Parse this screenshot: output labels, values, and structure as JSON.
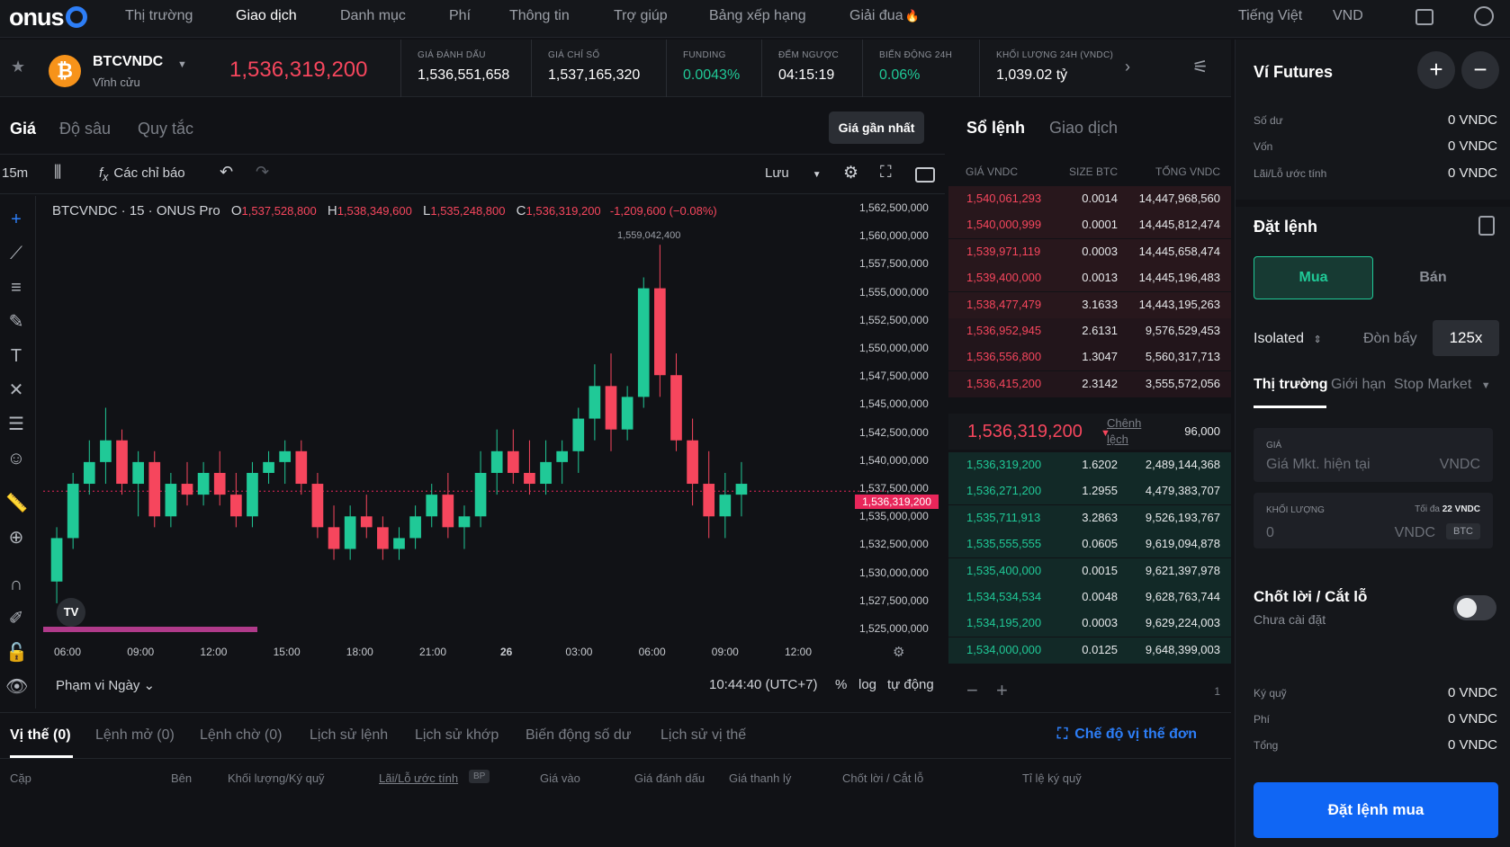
{
  "brand": {
    "name": "onus"
  },
  "nav": [
    "Thị trường",
    "Giao dịch",
    "Danh mục",
    "Phí",
    "Thông tin",
    "Trợ giúp",
    "Bảng xếp hạng",
    "Giải đua"
  ],
  "nav_right": {
    "lang": "Tiếng Việt",
    "currency": "VND"
  },
  "ticker": {
    "coin_letter": "₿",
    "symbol": "BTCVNDC",
    "type": "Vĩnh cửu",
    "last_price": "1,536,319,200",
    "stats": [
      {
        "label": "GIÁ ĐÁNH DẤU",
        "value": "1,536,551,658"
      },
      {
        "label": "GIÁ CHỈ SỐ",
        "value": "1,537,165,320"
      },
      {
        "label": "FUNDING",
        "value": "0.0043%"
      },
      {
        "label": "ĐẾM NGƯỢC",
        "value": "04:15:19"
      },
      {
        "label": "BIẾN ĐỘNG 24H",
        "value": "0.06%"
      },
      {
        "label": "KHỐI LƯỢNG 24H (VNDC)",
        "value": "1,039.02 tỷ"
      }
    ]
  },
  "chart_tabs": [
    "Giá",
    "Độ sâu",
    "Quy tắc"
  ],
  "last_price_button": "Giá gần nhất",
  "toolbar": {
    "interval": "15m",
    "indicators": "Các chỉ báo",
    "save": "Lưu"
  },
  "ohlc": {
    "title": "BTCVNDC · 15 · ONUS Pro",
    "o": "1,537,528,800",
    "h": "1,538,349,600",
    "l": "1,535,248,800",
    "c": "1,536,319,200",
    "change": "-1,209,600 (−0.08%)"
  },
  "chart_data": {
    "type": "candlestick",
    "symbol": "BTCVNDC",
    "interval": "15",
    "y_ticks": [
      "1,562,500,000",
      "1,560,000,000",
      "1,557,500,000",
      "1,555,000,000",
      "1,552,500,000",
      "1,550,000,000",
      "1,547,500,000",
      "1,545,000,000",
      "1,542,500,000",
      "1,540,000,000",
      "1,537,500,000",
      "1,535,000,000",
      "1,532,500,000",
      "1,530,000,000",
      "1,527,500,000",
      "1,525,000,000"
    ],
    "x_ticks": [
      "06:00",
      "09:00",
      "12:00",
      "15:00",
      "18:00",
      "21:00",
      "26",
      "03:00",
      "06:00",
      "09:00",
      "12:00"
    ],
    "ylim": [
      1525000000,
      1562500000
    ],
    "high_annotation": "1,559,042,400",
    "current_price_label": "1,536,319,200",
    "candles": [
      [
        1528000000,
        1533000000,
        1526000000,
        1532000000
      ],
      [
        1532000000,
        1538000000,
        1531000000,
        1537000000
      ],
      [
        1537000000,
        1541000000,
        1536000000,
        1539000000
      ],
      [
        1539000000,
        1544000000,
        1537000000,
        1541000000
      ],
      [
        1541000000,
        1542000000,
        1536000000,
        1537000000
      ],
      [
        1537000000,
        1540000000,
        1534000000,
        1539000000
      ],
      [
        1539000000,
        1540000000,
        1533000000,
        1534000000
      ],
      [
        1534000000,
        1538000000,
        1533000000,
        1537000000
      ],
      [
        1537000000,
        1539000000,
        1535000000,
        1536000000
      ],
      [
        1536000000,
        1539000000,
        1535000000,
        1538000000
      ],
      [
        1538000000,
        1540000000,
        1535000000,
        1536000000
      ],
      [
        1536000000,
        1538000000,
        1533000000,
        1534000000
      ],
      [
        1534000000,
        1539000000,
        1533000000,
        1538000000
      ],
      [
        1538000000,
        1540000000,
        1537000000,
        1539000000
      ],
      [
        1539000000,
        1541000000,
        1537000000,
        1540000000
      ],
      [
        1540000000,
        1541000000,
        1536000000,
        1537000000
      ],
      [
        1537000000,
        1538000000,
        1532000000,
        1533000000
      ],
      [
        1533000000,
        1535000000,
        1530000000,
        1531000000
      ],
      [
        1531000000,
        1535000000,
        1530000000,
        1534000000
      ],
      [
        1534000000,
        1536000000,
        1532000000,
        1533000000
      ],
      [
        1533000000,
        1534000000,
        1530000000,
        1531000000
      ],
      [
        1531000000,
        1533000000,
        1530000000,
        1532000000
      ],
      [
        1532000000,
        1535000000,
        1531000000,
        1534000000
      ],
      [
        1534000000,
        1537000000,
        1533000000,
        1536000000
      ],
      [
        1536000000,
        1538000000,
        1532000000,
        1533000000
      ],
      [
        1533000000,
        1535000000,
        1531000000,
        1534000000
      ],
      [
        1534000000,
        1540000000,
        1533000000,
        1538000000
      ],
      [
        1538000000,
        1542000000,
        1536000000,
        1540000000
      ],
      [
        1540000000,
        1542000000,
        1537000000,
        1538000000
      ],
      [
        1538000000,
        1541000000,
        1536000000,
        1537000000
      ],
      [
        1537000000,
        1541000000,
        1536000000,
        1539000000
      ],
      [
        1539000000,
        1541000000,
        1537000000,
        1540000000
      ],
      [
        1540000000,
        1544000000,
        1538000000,
        1543000000
      ],
      [
        1543000000,
        1548000000,
        1541000000,
        1546000000
      ],
      [
        1546000000,
        1549000000,
        1540000000,
        1542000000
      ],
      [
        1542000000,
        1546000000,
        1541000000,
        1545000000
      ],
      [
        1545000000,
        1556000000,
        1544000000,
        1555000000
      ],
      [
        1555000000,
        1559000000,
        1545000000,
        1547000000
      ],
      [
        1547000000,
        1549000000,
        1540000000,
        1541000000
      ],
      [
        1541000000,
        1543000000,
        1535000000,
        1537000000
      ],
      [
        1537000000,
        1540000000,
        1532000000,
        1534000000
      ],
      [
        1534000000,
        1538000000,
        1532000000,
        1536000000
      ],
      [
        1536000000,
        1539000000,
        1534000000,
        1537000000
      ]
    ]
  },
  "chart_footer": {
    "range": "Phạm vi Ngày",
    "time": "10:44:40 (UTC+7)",
    "pct": "%",
    "log": "log",
    "auto": "tự động"
  },
  "orderbook": {
    "tabs": [
      "Sổ lệnh",
      "Giao dịch"
    ],
    "headers": {
      "price": "GIÁ VNDC",
      "size": "SIZE BTC",
      "total": "TỔNG VNDC"
    },
    "asks": [
      [
        "1,540,061,293",
        "0.0014",
        "14,447,968,560"
      ],
      [
        "1,540,000,999",
        "0.0001",
        "14,445,812,474"
      ],
      [
        "1,539,971,119",
        "0.0003",
        "14,445,658,474"
      ],
      [
        "1,539,400,000",
        "0.0013",
        "14,445,196,483"
      ],
      [
        "1,538,477,479",
        "3.1633",
        "14,443,195,263"
      ],
      [
        "1,536,952,945",
        "2.6131",
        "9,576,529,453"
      ],
      [
        "1,536,556,800",
        "1.3047",
        "5,560,317,713"
      ],
      [
        "1,536,415,200",
        "2.3142",
        "3,555,572,056"
      ]
    ],
    "mid_price": "1,536,319,200",
    "spread_label": "Chênh lệch",
    "spread_value": "96,000",
    "bids": [
      [
        "1,536,319,200",
        "1.6202",
        "2,489,144,368"
      ],
      [
        "1,536,271,200",
        "1.2955",
        "4,479,383,707"
      ],
      [
        "1,535,711,913",
        "3.2863",
        "9,526,193,767"
      ],
      [
        "1,535,555,555",
        "0.0605",
        "9,619,094,878"
      ],
      [
        "1,535,400,000",
        "0.0015",
        "9,621,397,978"
      ],
      [
        "1,534,534,534",
        "0.0048",
        "9,628,763,744"
      ],
      [
        "1,534,195,200",
        "0.0003",
        "9,629,224,003"
      ],
      [
        "1,534,000,000",
        "0.0125",
        "9,648,399,003"
      ]
    ],
    "depth_value": "1"
  },
  "bottom_tabs": [
    "Vị thế (0)",
    "Lệnh mở (0)",
    "Lệnh chờ (0)",
    "Lịch sử lệnh",
    "Lịch sử khớp",
    "Biến động số dư",
    "Lịch sử vị thế"
  ],
  "single_mode": "Chế độ vị thế đơn",
  "position_columns": [
    "Cặp",
    "Bên",
    "Khối lượng/Ký quỹ",
    "Lãi/Lỗ ước tính",
    "Giá vào",
    "Giá đánh dấu",
    "Giá thanh lý",
    "Chốt lời / Cắt lỗ",
    "Tỉ lệ ký quỹ"
  ],
  "bp_badge": "BP",
  "wallet": {
    "title": "Ví Futures",
    "rows": [
      [
        "Số dư",
        "0 VNDC"
      ],
      [
        "Vốn",
        "0 VNDC"
      ],
      [
        "Lãi/Lỗ ước tính",
        "0 VNDC"
      ]
    ]
  },
  "order": {
    "title": "Đặt lệnh",
    "buy": "Mua",
    "sell": "Bán",
    "margin_mode": "Isolated",
    "leverage_label": "Đòn bẩy",
    "leverage": "125x",
    "types": [
      "Thị trường",
      "Giới hạn",
      "Stop Market"
    ],
    "price_label": "GIÁ",
    "price_placeholder": "Giá Mkt. hiện tại",
    "price_unit": "VNDC",
    "qty_label": "KHỐI LƯỢNG",
    "qty_max": "Tối đa",
    "qty_max_value": "22 VNDC",
    "qty_value": "0",
    "qty_unit": "VNDC",
    "qty_toggle": "BTC",
    "tpsl_title": "Chốt lời / Cắt lỗ",
    "tpsl_status": "Chưa cài đặt",
    "summary": [
      [
        "Ký quỹ",
        "0 VNDC"
      ],
      [
        "Phí",
        "0 VNDC"
      ],
      [
        "Tổng",
        "0 VNDC"
      ]
    ],
    "submit": "Đặt lệnh mua"
  },
  "colors": {
    "up": "#20c997",
    "down": "#f6465d",
    "accent": "#1066f4"
  }
}
